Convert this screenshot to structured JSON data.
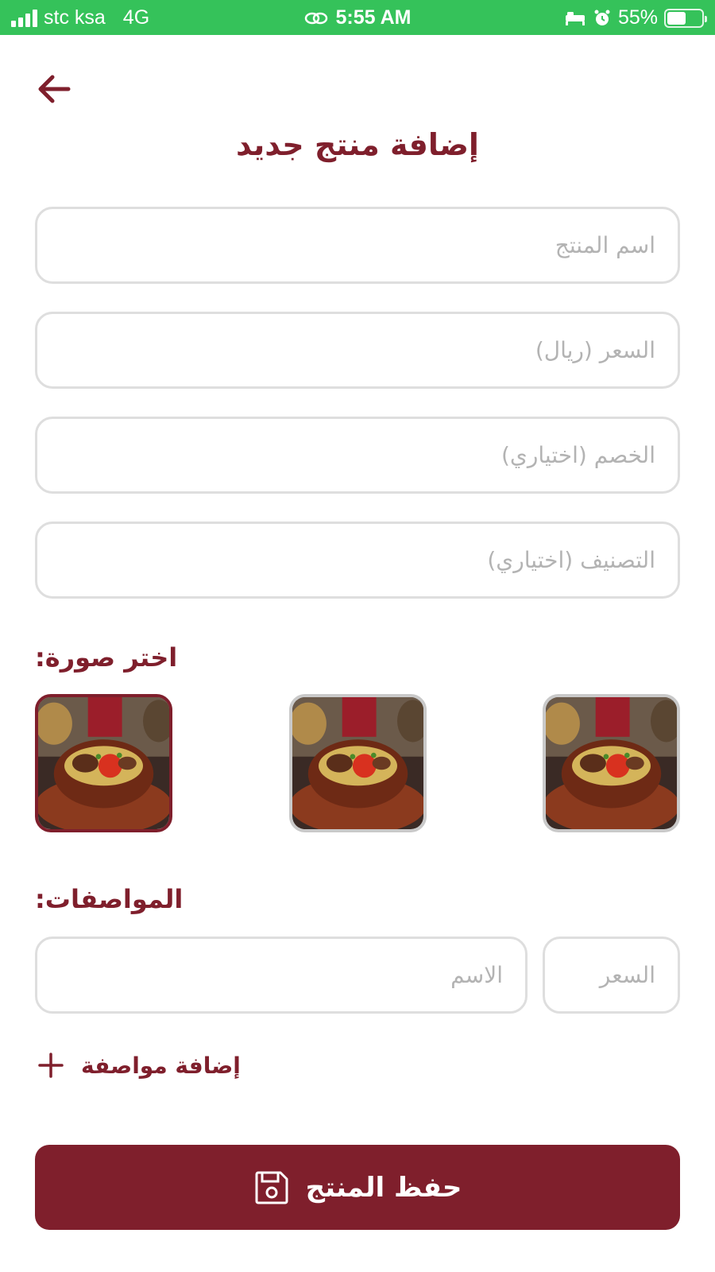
{
  "status_bar": {
    "carrier": "stc ksa",
    "network": "4G",
    "time": "5:55 AM",
    "battery_percent": "55%",
    "battery_level": 0.55,
    "color": "#35c25a"
  },
  "header": {
    "back_icon": "arrow-left-icon",
    "title": "إضافة منتج جديد"
  },
  "form": {
    "product_name": {
      "value": "",
      "placeholder": "اسم المنتج"
    },
    "price": {
      "value": "",
      "placeholder": "السعر (ريال)"
    },
    "discount": {
      "value": "",
      "placeholder": "الخصم (اختياري)"
    },
    "category": {
      "value": "",
      "placeholder": "التصنيف (اختياري)"
    }
  },
  "image_picker": {
    "label": "اختر صورة:",
    "selected_index": 0,
    "options": [
      "food-image",
      "food-image",
      "food-image"
    ]
  },
  "specs": {
    "label": "المواصفات:",
    "name_field": {
      "value": "",
      "placeholder": "الاسم"
    },
    "price_field": {
      "value": "",
      "placeholder": "السعر"
    },
    "add_label": "إضافة مواصفة",
    "add_icon": "plus-icon"
  },
  "save_button": {
    "label": "حفظ المنتج",
    "icon": "floppy-disk-icon"
  },
  "colors": {
    "accent": "#7f1f2c",
    "border": "#dedede",
    "placeholder": "#b3b3b3"
  }
}
